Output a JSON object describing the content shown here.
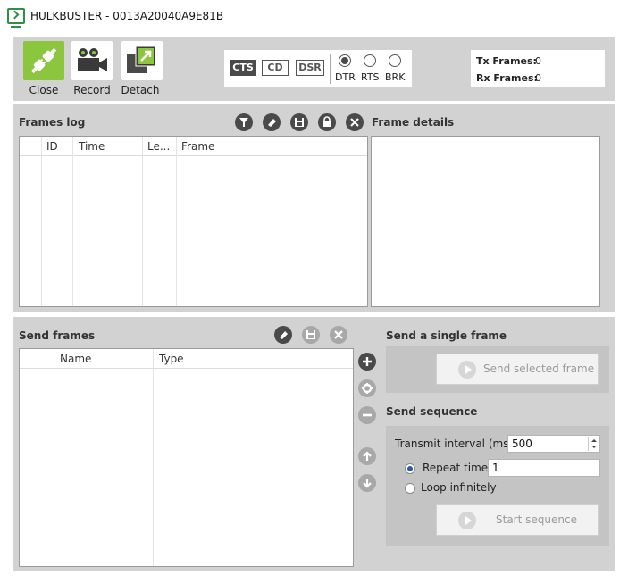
{
  "window": {
    "title": "HULKBUSTER - 0013A20040A9E81B"
  },
  "toolbar": {
    "close_label": "Close",
    "record_label": "Record",
    "detach_label": "Detach"
  },
  "lines": {
    "cts": "CTS",
    "cd": "CD",
    "dsr": "DSR",
    "dtr": "DTR",
    "rts": "RTS",
    "brk": "BRK"
  },
  "counters": {
    "tx_label": "Tx Frames:",
    "tx_value": "0",
    "rx_label": "Rx Frames:",
    "rx_value": "0"
  },
  "frames_log": {
    "title": "Frames log",
    "columns": [
      "ID",
      "Time",
      "Le...",
      "Frame"
    ]
  },
  "frame_details": {
    "title": "Frame details"
  },
  "send_frames": {
    "title": "Send frames",
    "columns": [
      "Name",
      "Type"
    ]
  },
  "single_frame": {
    "title": "Send a single frame",
    "button": "Send selected frame"
  },
  "sequence": {
    "title": "Send sequence",
    "interval_label": "Transmit interval (ms):",
    "interval_value": "500",
    "repeat_label": "Repeat times",
    "repeat_value": "1",
    "loop_label": "Loop infinitely",
    "start_button": "Start sequence"
  },
  "colors": {
    "accent_green": "#8cc63f",
    "panel_gray": "#d2d2d2",
    "dark_icon": "#4a4a4a"
  }
}
